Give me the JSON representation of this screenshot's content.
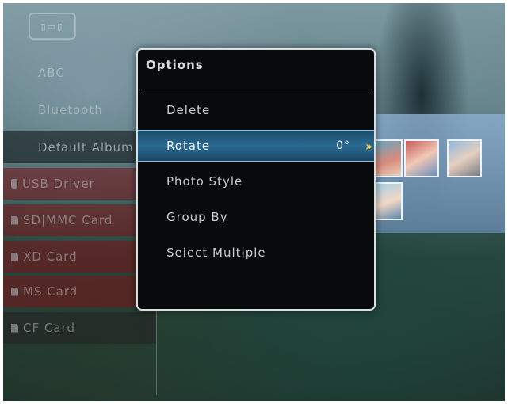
{
  "options_dialog": {
    "title": "Options",
    "items": [
      {
        "label": "Delete"
      },
      {
        "label": "Rotate",
        "value": "0°",
        "selected": true
      },
      {
        "label": "Photo Style"
      },
      {
        "label": "Group By"
      },
      {
        "label": "Select Multiple"
      }
    ],
    "selected_accent": "#2a6a92",
    "chevron_icon": "double-chevron-right-icon",
    "chevron_color": "#f2c23a"
  },
  "left_menu": {
    "items": [
      {
        "label": "ABC"
      },
      {
        "label": "Bluetooth"
      },
      {
        "label": "Default Album"
      },
      {
        "label": "USB Driver",
        "icon": "usb-icon"
      },
      {
        "label": "SD|MMC Card",
        "icon": "card-icon"
      },
      {
        "label": "XD Card",
        "icon": "card-icon"
      },
      {
        "label": "MS Card",
        "icon": "card-icon"
      },
      {
        "label": "CF Card",
        "icon": "card-icon"
      }
    ]
  }
}
